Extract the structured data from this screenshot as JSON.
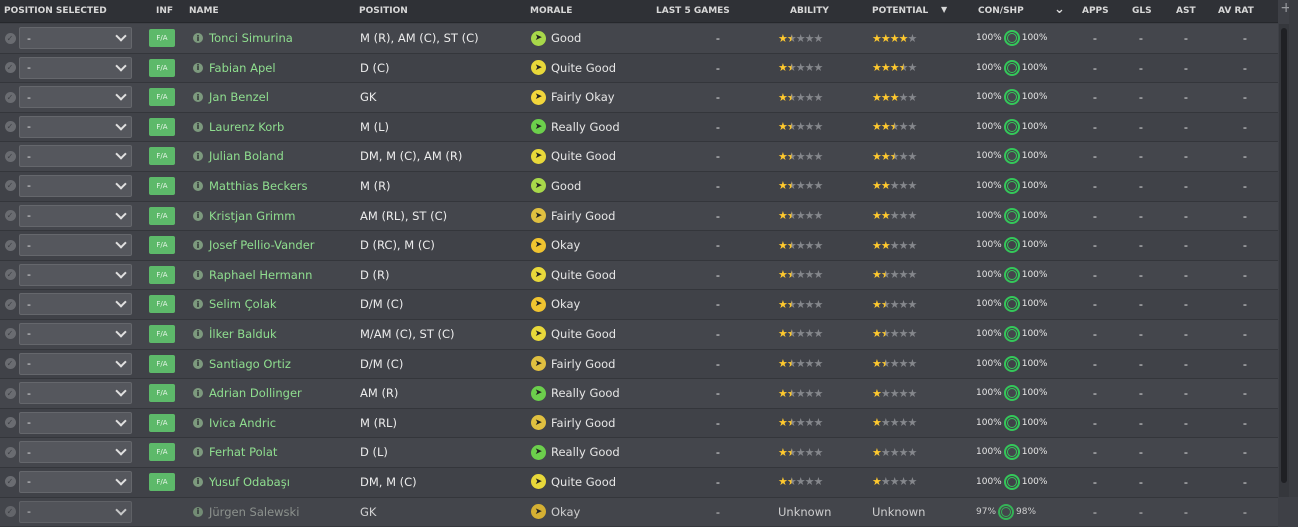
{
  "columns": {
    "position_selected": "POSITION SELECTED",
    "inf": "INF",
    "name": "NAME",
    "position": "POSITION",
    "morale": "MORALE",
    "last5": "LAST 5 GAMES",
    "ability": "ABILITY",
    "potential": "POTENTIAL",
    "con_shp": "CON/SHP",
    "apps": "APPS",
    "gls": "GLS",
    "ast": "AST",
    "av_rat": "AV RAT"
  },
  "morale_colors": {
    "Good": "#a8d84a",
    "Quite Good": "#e8d83a",
    "Fairly Okay": "#f2d63c",
    "Really Good": "#6ccf4c",
    "Okay": "#f0c430"
  },
  "players": [
    {
      "sel": "-",
      "inf": "F/A",
      "name": "Tonci Simurina",
      "position": "M (R), AM (C), ST (C)",
      "morale": "Good",
      "last5": "-",
      "ability": 1.5,
      "potential": 4,
      "con": "100%",
      "shp": "100%",
      "apps": "-",
      "gls": "-",
      "ast": "-",
      "avr": "-"
    },
    {
      "sel": "-",
      "inf": "F/A",
      "name": "Fabian Apel",
      "position": "D (C)",
      "morale": "Quite Good",
      "last5": "-",
      "ability": 1.5,
      "potential": 3.5,
      "con": "100%",
      "shp": "100%",
      "apps": "-",
      "gls": "-",
      "ast": "-",
      "avr": "-"
    },
    {
      "sel": "-",
      "inf": "F/A",
      "name": "Jan Benzel",
      "position": "GK",
      "morale": "Fairly Okay",
      "last5": "-",
      "ability": 1.5,
      "potential": 3,
      "con": "100%",
      "shp": "100%",
      "apps": "-",
      "gls": "-",
      "ast": "-",
      "avr": "-"
    },
    {
      "sel": "-",
      "inf": "F/A",
      "name": "Laurenz Korb",
      "position": "M (L)",
      "morale": "Really Good",
      "last5": "-",
      "ability": 1.5,
      "potential": 2.5,
      "con": "100%",
      "shp": "100%",
      "apps": "-",
      "gls": "-",
      "ast": "-",
      "avr": "-"
    },
    {
      "sel": "-",
      "inf": "F/A",
      "name": "Julian Boland",
      "position": "DM, M (C), AM (R)",
      "morale": "Quite Good",
      "last5": "-",
      "ability": 1.5,
      "potential": 2.5,
      "con": "100%",
      "shp": "100%",
      "apps": "-",
      "gls": "-",
      "ast": "-",
      "avr": "-"
    },
    {
      "sel": "-",
      "inf": "F/A",
      "name": "Matthias Beckers",
      "position": "M (R)",
      "morale": "Good",
      "last5": "-",
      "ability": 1.5,
      "potential": 2,
      "con": "100%",
      "shp": "100%",
      "apps": "-",
      "gls": "-",
      "ast": "-",
      "avr": "-"
    },
    {
      "sel": "-",
      "inf": "F/A",
      "name": "Kristjan Grimm",
      "position": "AM (RL), ST (C)",
      "morale": "Fairly Good",
      "last5": "-",
      "ability": 1.5,
      "potential": 2,
      "con": "100%",
      "shp": "100%",
      "apps": "-",
      "gls": "-",
      "ast": "-",
      "avr": "-"
    },
    {
      "sel": "-",
      "inf": "F/A",
      "name": "Josef Pellio-Vander",
      "position": "D (RC), M (C)",
      "morale": "Okay",
      "last5": "-",
      "ability": 1.5,
      "potential": 2,
      "con": "100%",
      "shp": "100%",
      "apps": "-",
      "gls": "-",
      "ast": "-",
      "avr": "-"
    },
    {
      "sel": "-",
      "inf": "F/A",
      "name": "Raphael Hermann",
      "position": "D (R)",
      "morale": "Quite Good",
      "last5": "-",
      "ability": 1.5,
      "potential": 1.5,
      "con": "100%",
      "shp": "100%",
      "apps": "-",
      "gls": "-",
      "ast": "-",
      "avr": "-"
    },
    {
      "sel": "-",
      "inf": "F/A",
      "name": "Selim Çolak",
      "position": "D/M (C)",
      "morale": "Okay",
      "last5": "-",
      "ability": 1.5,
      "potential": 1.5,
      "con": "100%",
      "shp": "100%",
      "apps": "-",
      "gls": "-",
      "ast": "-",
      "avr": "-"
    },
    {
      "sel": "-",
      "inf": "F/A",
      "name": "İlker Balduk",
      "position": "M/AM (C), ST (C)",
      "morale": "Quite Good",
      "last5": "-",
      "ability": 1.5,
      "potential": 1.5,
      "con": "100%",
      "shp": "100%",
      "apps": "-",
      "gls": "-",
      "ast": "-",
      "avr": "-"
    },
    {
      "sel": "-",
      "inf": "F/A",
      "name": "Santiago Ortiz",
      "position": "D/M (C)",
      "morale": "Fairly Good",
      "last5": "-",
      "ability": 1.5,
      "potential": 1.5,
      "con": "100%",
      "shp": "100%",
      "apps": "-",
      "gls": "-",
      "ast": "-",
      "avr": "-"
    },
    {
      "sel": "-",
      "inf": "F/A",
      "name": "Adrian Dollinger",
      "position": "AM (R)",
      "morale": "Really Good",
      "last5": "-",
      "ability": 1.5,
      "potential": 1,
      "con": "100%",
      "shp": "100%",
      "apps": "-",
      "gls": "-",
      "ast": "-",
      "avr": "-"
    },
    {
      "sel": "-",
      "inf": "F/A",
      "name": "Ivica Andric",
      "position": "M (RL)",
      "morale": "Fairly Good",
      "last5": "-",
      "ability": 1.5,
      "potential": 1,
      "con": "100%",
      "shp": "100%",
      "apps": "-",
      "gls": "-",
      "ast": "-",
      "avr": "-"
    },
    {
      "sel": "-",
      "inf": "F/A",
      "name": "Ferhat Polat",
      "position": "D (L)",
      "morale": "Really Good",
      "last5": "-",
      "ability": 1.5,
      "potential": 1,
      "con": "100%",
      "shp": "100%",
      "apps": "-",
      "gls": "-",
      "ast": "-",
      "avr": "-"
    },
    {
      "sel": "-",
      "inf": "F/A",
      "name": "Yusuf Odabaşı",
      "position": "DM, M (C)",
      "morale": "Quite Good",
      "last5": "-",
      "ability": 1.5,
      "potential": 1,
      "con": "100%",
      "shp": "100%",
      "apps": "-",
      "gls": "-",
      "ast": "-",
      "avr": "-"
    },
    {
      "sel": "-",
      "inf": "",
      "name": "Jürgen Salewski",
      "position": "GK",
      "morale": "Okay",
      "last5": "-",
      "ability_text": "Unknown",
      "potential_text": "Unknown",
      "con": "97%",
      "shp": "98%",
      "apps": "-",
      "gls": "-",
      "ast": "-",
      "avr": "-"
    }
  ]
}
